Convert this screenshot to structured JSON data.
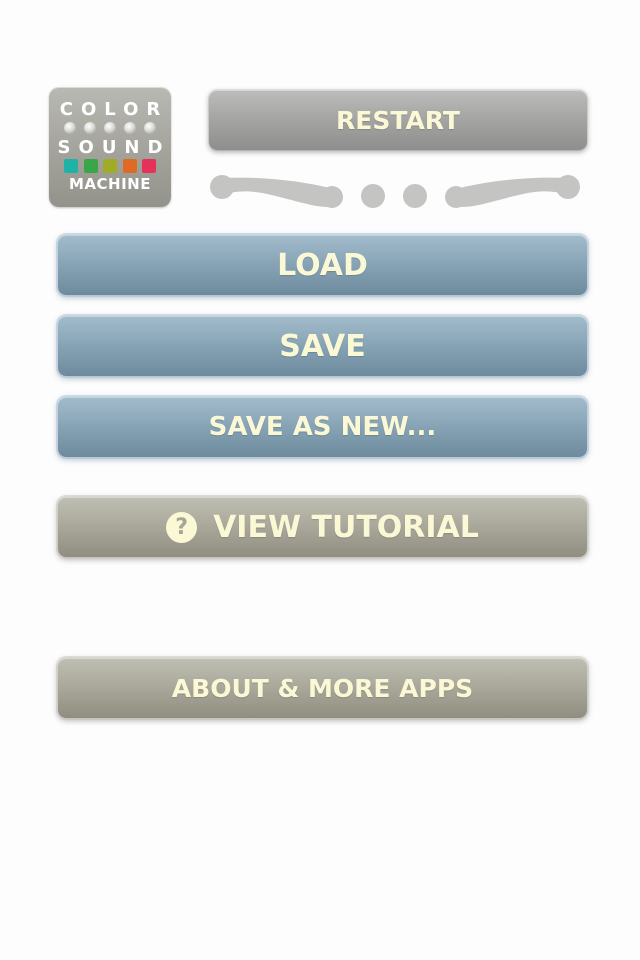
{
  "logo": {
    "line1": "COLOR",
    "line2": "SOUND",
    "line3": "MACHINE",
    "square_colors": [
      "#1fb3a6",
      "#3aa64a",
      "#a0ab26",
      "#df6a23",
      "#e5325a"
    ]
  },
  "buttons": {
    "restart": "RESTART",
    "load": "LOAD",
    "save": "SAVE",
    "save_as_new": "SAVE AS NEW...",
    "view_tutorial": "VIEW TUTORIAL",
    "tutorial_icon_glyph": "?",
    "about": "ABOUT & MORE APPS"
  },
  "icons": {
    "tutorial": "help-circle-icon",
    "ornament": "swirl-divider-icon"
  },
  "colors": {
    "button_text": "#fbf8d6",
    "gray_button": "#a4a4a2",
    "blue_button": "#86a3b5",
    "olive_button": "#a8a79a",
    "ornament": "#c4c4c2"
  }
}
